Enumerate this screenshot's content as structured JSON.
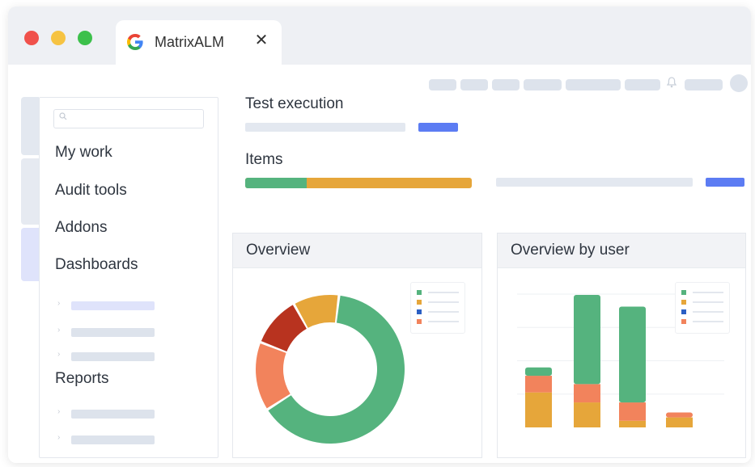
{
  "browser": {
    "tab_title": "MatrixALM",
    "tab_icon": "google-g-icon",
    "close_glyph": "✕"
  },
  "sidebar": {
    "items": [
      {
        "label": "My work"
      },
      {
        "label": "Audit tools"
      },
      {
        "label": "Addons"
      },
      {
        "label": "Dashboards"
      },
      {
        "label": "Reports"
      }
    ]
  },
  "main": {
    "test_execution_title": "Test execution",
    "items_title": "Items",
    "items_progress": {
      "green_fraction": 0.27,
      "orange_fraction": 0.73
    }
  },
  "overview": {
    "title": "Overview",
    "chart_data": {
      "type": "pie",
      "variant": "donut",
      "slices": [
        {
          "color": "#55b37e",
          "value": 64
        },
        {
          "color": "#f2835c",
          "value": 15
        },
        {
          "color": "#b8331f",
          "value": 11
        },
        {
          "color": "#e6a63a",
          "value": 10
        }
      ]
    }
  },
  "overview_by_user": {
    "title": "Overview by user",
    "chart_data": {
      "type": "bar",
      "stacked": true,
      "categories": [
        "",
        "",
        "",
        ""
      ],
      "ylim": [
        0,
        160
      ],
      "series": [
        {
          "color": "#e6a63a",
          "values": [
            42,
            30,
            8,
            12
          ]
        },
        {
          "color": "#f2835c",
          "values": [
            20,
            22,
            22,
            6
          ]
        },
        {
          "color": "#55b37e",
          "values": [
            10,
            107,
            115,
            0
          ]
        }
      ]
    }
  },
  "colors": {
    "green": "#55b37e",
    "orange": "#e6a63a",
    "salmon": "#f2835c",
    "darkred": "#b8331f",
    "blue": "#5c7cf3",
    "legend_blue": "#2b5fc4",
    "skeleton": "#dde3ec"
  }
}
